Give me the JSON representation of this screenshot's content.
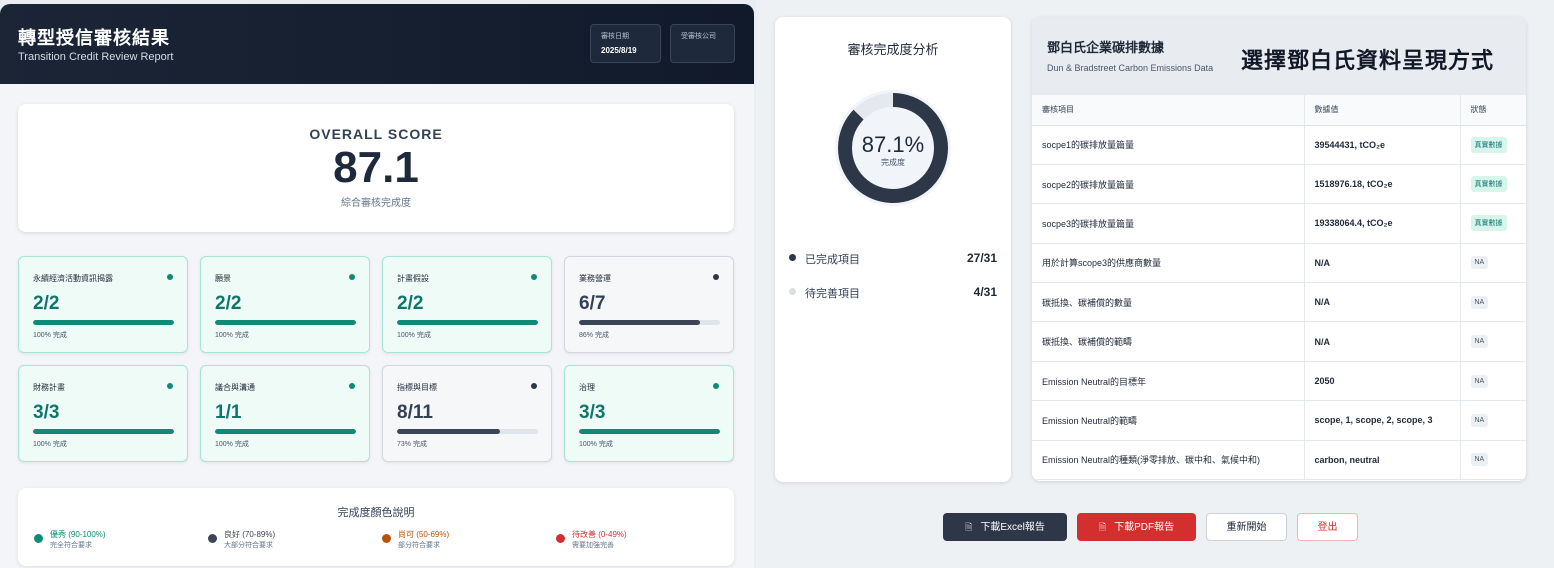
{
  "header": {
    "title": "轉型授信審核結果",
    "subtitle": "Transition Credit Review Report",
    "review_date_label": "審核日期",
    "review_date": "2025/8/19",
    "company_label": "受審核公司"
  },
  "overall": {
    "label": "OVERALL SCORE",
    "score": "87.1",
    "desc": "綜合審核完成度"
  },
  "categories": [
    {
      "name": "永續經濟活動資訊揭露",
      "value": "2/2",
      "pct": "100% 完成",
      "fraction": 1.0,
      "status": "excellent"
    },
    {
      "name": "願景",
      "value": "2/2",
      "pct": "100% 完成",
      "fraction": 1.0,
      "status": "excellent"
    },
    {
      "name": "計畫假設",
      "value": "2/2",
      "pct": "100% 完成",
      "fraction": 1.0,
      "status": "excellent"
    },
    {
      "name": "業務營運",
      "value": "6/7",
      "pct": "86% 完成",
      "fraction": 0.86,
      "status": "good"
    },
    {
      "name": "財務計畫",
      "value": "3/3",
      "pct": "100% 完成",
      "fraction": 1.0,
      "status": "excellent"
    },
    {
      "name": "議合與溝通",
      "value": "1/1",
      "pct": "100% 完成",
      "fraction": 1.0,
      "status": "excellent"
    },
    {
      "name": "指標與目標",
      "value": "8/11",
      "pct": "73% 完成",
      "fraction": 0.73,
      "status": "good"
    },
    {
      "name": "治理",
      "value": "3/3",
      "pct": "100% 完成",
      "fraction": 1.0,
      "status": "excellent"
    }
  ],
  "legend": {
    "title": "完成度顏色說明",
    "items": [
      {
        "label": "優秀 (90-100%)",
        "desc": "完全符合要求",
        "color": "#0f8a76"
      },
      {
        "label": "良好 (70-89%)",
        "desc": "大部分符合要求",
        "color": "#3b4556"
      },
      {
        "label": "尚可 (50-69%)",
        "desc": "部分符合要求",
        "color": "#b45309"
      },
      {
        "label": "待改善 (0-49%)",
        "desc": "需要加強完善",
        "color": "#d32f2f"
      }
    ]
  },
  "analysis": {
    "title": "審核完成度分析",
    "percent": "87.1%",
    "percent_value": 0.871,
    "sub": "完成度",
    "completed_label": "已完成項目",
    "completed_value": "27/31",
    "pending_label": "待完善項目",
    "pending_value": "4/31"
  },
  "dnb": {
    "title": "鄧白氏企業碳排數據",
    "subtitle": "Dun & Bradstreet Carbon Emissions Data",
    "big_heading": "選擇鄧白氏資料呈現方式",
    "columns": [
      "審核項目",
      "數據值",
      "狀態"
    ],
    "rows": [
      {
        "item": "socpe1的碳排放量篇量",
        "value": "39544431, tCO₂e",
        "status": "真實數據",
        "kind": "ok"
      },
      {
        "item": "socpe2的碳排放量篇量",
        "value": "1518976.18, tCO₂e",
        "status": "真實數據",
        "kind": "ok"
      },
      {
        "item": "socpe3的碳排放量篇量",
        "value": "19338064.4, tCO₂e",
        "status": "真實數據",
        "kind": "ok"
      },
      {
        "item": "用於計算scope3的供應商數量",
        "value": "N/A",
        "status": "NA",
        "kind": "na"
      },
      {
        "item": "碳抵換、碳補償的數量",
        "value": "N/A",
        "status": "NA",
        "kind": "na"
      },
      {
        "item": "碳抵換、碳補償的範疇",
        "value": "N/A",
        "status": "NA",
        "kind": "na"
      },
      {
        "item": "Emission Neutral的目標年",
        "value": "2050",
        "status": "NA",
        "kind": "na"
      },
      {
        "item": "Emission Neutral的範疇",
        "value": "scope, 1, scope, 2, scope, 3",
        "status": "NA",
        "kind": "na"
      },
      {
        "item": "Emission Neutral的種類(淨零排放、碳中和、氣候中和)",
        "value": "carbon, neutral",
        "status": "NA",
        "kind": "na"
      }
    ]
  },
  "buttons": {
    "excel": "下載Excel報告",
    "pdf": "下載PDF報告",
    "restart": "重新開始",
    "logout": "登出"
  },
  "colors": {
    "excellent": "#0f8a76",
    "good": "#3b4556",
    "header_bg": "#111a2a",
    "pdf_button": "#d32f2f",
    "excel_button": "#2d3748"
  }
}
